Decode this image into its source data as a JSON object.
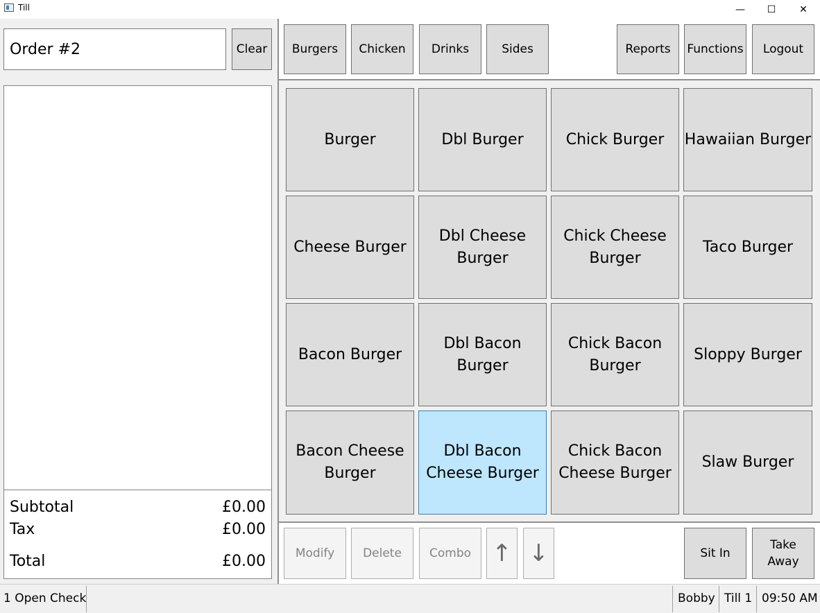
{
  "window": {
    "title": "Till",
    "minimize": "—",
    "maximize": "☐",
    "close": "✕"
  },
  "order": {
    "title": "Order #2",
    "clear_label": "Clear"
  },
  "categories": [
    "Burgers",
    "Chicken",
    "Drinks",
    "Sides"
  ],
  "actions_top": [
    "Reports",
    "Functions",
    "Logout"
  ],
  "items": [
    "Burger",
    "Dbl Burger",
    "Chick Burger",
    "Hawaiian Burger",
    "Cheese Burger",
    "Dbl Cheese Burger",
    "Chick Cheese Burger",
    "Taco Burger",
    "Bacon Burger",
    "Dbl Bacon Burger",
    "Chick Bacon Burger",
    "Sloppy Burger",
    "Bacon Cheese Burger",
    "Dbl Bacon Cheese Burger",
    "Chick Bacon Cheese Burger",
    "Slaw Burger"
  ],
  "totals": {
    "subtotal_label": "Subtotal",
    "subtotal": "£0.00",
    "tax_label": "Tax",
    "tax": "£0.00",
    "total_label": "Total",
    "total": "£0.00"
  },
  "bottom_actions": {
    "modify": "Modify",
    "delete": "Delete",
    "combo": "Combo",
    "up": "↑",
    "down": "↓",
    "sit_in": "Sit In",
    "take_away": "Take Away"
  },
  "status": {
    "open_checks": "1 Open Check",
    "user": "Bobby",
    "till": "Till 1",
    "time": "09:50 AM"
  }
}
